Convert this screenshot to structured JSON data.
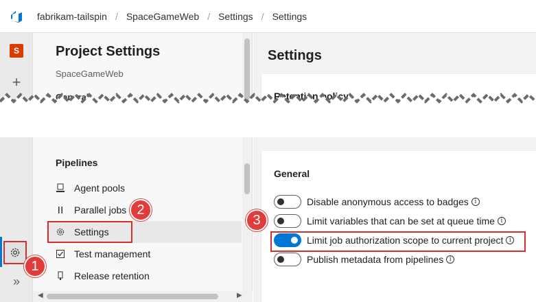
{
  "topbar": {
    "breadcrumbs": [
      "fabrikam-tailspin",
      "SpaceGameWeb",
      "Settings",
      "Settings"
    ],
    "separator": "/"
  },
  "rail": {
    "project_initial": "S"
  },
  "nav": {
    "title": "Project Settings",
    "subtitle": "SpaceGameWeb",
    "general_fragment": "General",
    "section": "Pipelines",
    "items": [
      {
        "label": "Agent pools",
        "icon": "agent-pools-icon"
      },
      {
        "label": "Parallel jobs",
        "icon": "parallel-jobs-icon"
      },
      {
        "label": "Settings",
        "icon": "gear-icon"
      },
      {
        "label": "Test management",
        "icon": "test-management-icon"
      },
      {
        "label": "Release retention",
        "icon": "release-retention-icon"
      }
    ]
  },
  "main": {
    "title": "Settings",
    "retention_fragment": "Retention policy",
    "general_title": "General",
    "toggles": [
      {
        "label": "Disable anonymous access to badges",
        "on": false
      },
      {
        "label": "Limit variables that can be set at queue time",
        "on": false
      },
      {
        "label": "Limit job authorization scope to current project",
        "on": true
      },
      {
        "label": "Publish metadata from pipelines",
        "on": false
      }
    ]
  },
  "callouts": [
    "1",
    "2",
    "3"
  ],
  "colors": {
    "accent": "#0078d4",
    "callout": "#e23b3b",
    "highlight": "#d32f2f",
    "project_badge": "#da3b01"
  }
}
